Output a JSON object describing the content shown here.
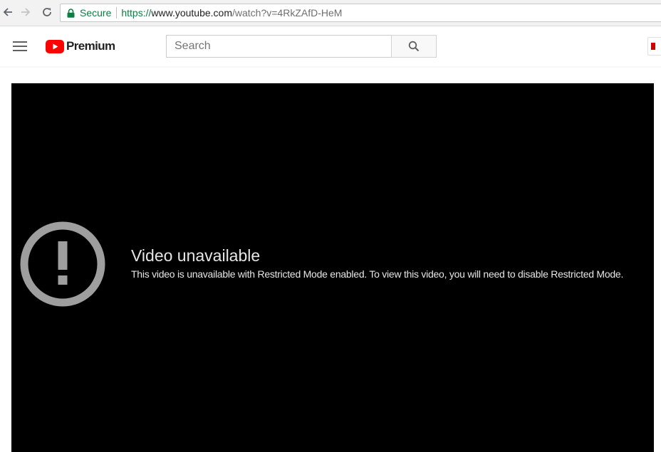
{
  "browser": {
    "secure_label": "Secure",
    "url": {
      "scheme": "https://",
      "host": "www.youtube.com",
      "path": "/watch?v=4RkZAfD-HeM"
    }
  },
  "header": {
    "logo_text": "Premium",
    "search_placeholder": "Search"
  },
  "player": {
    "error_title": "Video unavailable",
    "error_message": "This video is unavailable with Restricted Mode enabled. To view this video, you will need to disable Restricted Mode."
  },
  "colors": {
    "brand_red": "#ff0000",
    "secure_green": "#0b8043",
    "player_bg": "#000000",
    "error_icon": "#9e9e9e"
  }
}
